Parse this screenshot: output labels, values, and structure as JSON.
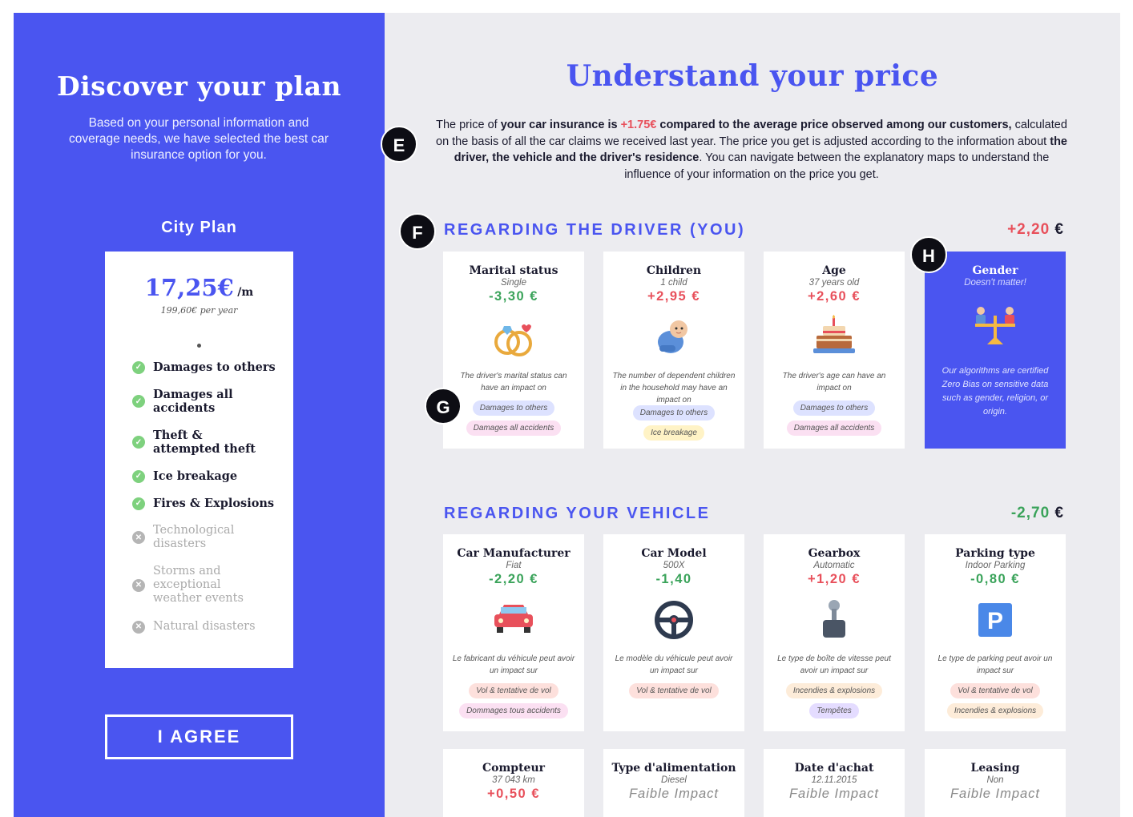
{
  "left": {
    "title": "Discover your plan",
    "subtitle": "Based on your personal information and coverage needs, we have selected the best car insurance option for you.",
    "plan_name": "City Plan",
    "price": "17,25€",
    "price_unit": "/m",
    "price_year": "199,60€ per year",
    "coverages": [
      {
        "label": "Damages to others",
        "included": true
      },
      {
        "label": "Damages all accidents",
        "included": true
      },
      {
        "label": "Theft & attempted theft",
        "included": true
      },
      {
        "label": "Ice breakage",
        "included": true
      },
      {
        "label": "Fires & Explosions",
        "included": true
      },
      {
        "label": "Technological disasters",
        "included": false
      },
      {
        "label": "Storms and exceptional weather events",
        "included": false
      },
      {
        "label": "Natural disasters",
        "included": false
      }
    ],
    "agree_label": "I AGREE"
  },
  "right": {
    "title": "Understand your price",
    "intro": {
      "p1": "The price of ",
      "b1": "your car insurance is ",
      "delta": "+1.75€",
      "b2": " compared to the average price observed among our customers,",
      "p2": " calculated on the basis of all the car claims we received last year. The price you get is adjusted according to the information about ",
      "b3": "the driver, the vehicle and the driver's residence",
      "p3": ". You can navigate between the explanatory maps to understand the influence of your information on the price you get."
    },
    "driver_section": {
      "title": "REGARDING THE DRIVER (YOU)",
      "delta": "+2,20",
      "currency": "€",
      "cards": [
        {
          "title": "Marital status",
          "sub": "Single",
          "delta": "-3,30 €",
          "text": "The driver's marital status can have an impact on",
          "chips": [
            "Damages to others",
            "Damages all accidents"
          ]
        },
        {
          "title": "Children",
          "sub": "1 child",
          "delta": "+2,95 €",
          "text": "The number of dependent children in the household may have an impact on",
          "chips": [
            "Damages to others",
            "Ice breakage"
          ]
        },
        {
          "title": "Age",
          "sub": "37 years old",
          "delta": "+2,60 €",
          "text": "The driver's age can have an impact on",
          "chips": [
            "Damages to others",
            "Damages all accidents"
          ]
        },
        {
          "title": "Gender",
          "sub": "Doesn't matter!",
          "text": "Our algorithms are certified Zero Bias on sensitive data such as gender, religion, or origin."
        }
      ]
    },
    "vehicle_section": {
      "title": "REGARDING YOUR VEHICLE",
      "delta": "-2,70",
      "currency": "€",
      "cards": [
        {
          "title": "Car Manufacturer",
          "sub": "Fiat",
          "delta": "-2,20 €",
          "text": "Le fabricant du véhicule peut avoir un impact sur",
          "chips": [
            "Vol & tentative de vol",
            "Dommages tous accidents"
          ]
        },
        {
          "title": "Car Model",
          "sub": "500X",
          "delta": "-1,40",
          "text": "Le modèle du véhicule peut avoir un impact sur",
          "chips": [
            "Vol & tentative de vol"
          ]
        },
        {
          "title": "Gearbox",
          "sub": "Automatic",
          "delta": "+1,20 €",
          "text": "Le type de boîte de vitesse peut avoir un impact sur",
          "chips": [
            "Incendies & explosions",
            "Tempêtes"
          ]
        },
        {
          "title": "Parking type",
          "sub": "Indoor Parking",
          "delta": "-0,80 €",
          "text": "Le type de parking peut avoir un impact sur",
          "chips": [
            "Vol & tentative de vol",
            "Incendies & explosions"
          ]
        }
      ],
      "cards_row2": [
        {
          "title": "Compteur",
          "sub": "37 043 km",
          "delta": "+0,50 €"
        },
        {
          "title": "Type d'alimentation",
          "sub": "Diesel",
          "delta": "Faible Impact"
        },
        {
          "title": "Date d'achat",
          "sub": "12.11.2015",
          "delta": "Faible Impact"
        },
        {
          "title": "Leasing",
          "sub": "Non",
          "delta": "Faible Impact"
        }
      ]
    }
  },
  "markers": [
    "E",
    "F",
    "G",
    "H"
  ],
  "icons": {
    "check": "check-icon",
    "cross": "cross-icon"
  },
  "colors": {
    "brand": "#4a55f0",
    "negative": "#3aa35a",
    "positive": "#e8505b",
    "background": "#ececf0"
  }
}
